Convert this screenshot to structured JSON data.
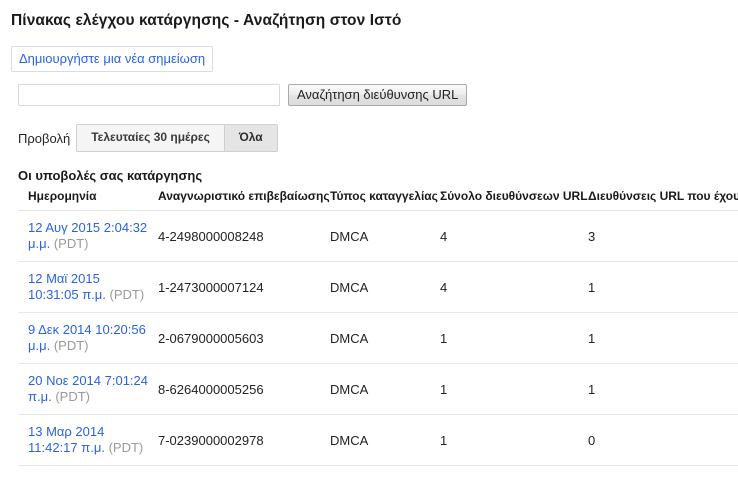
{
  "header": {
    "title": "Πίνακας ελέγχου κατάργησης - Αναζήτηση στον Ιστό"
  },
  "actions": {
    "new_notice_label": "Δημιουργήστε μια νέα σημείωση"
  },
  "search": {
    "value": "",
    "placeholder": "",
    "button_label": "Αναζήτηση διεύθυνσης URL"
  },
  "filter": {
    "label": "Προβολή",
    "options": [
      {
        "label": "Τελευταίες 30 ημέρες",
        "active": false
      },
      {
        "label": "Όλα",
        "active": true
      }
    ]
  },
  "table": {
    "heading": "Οι υποβολές σας κατάργησης",
    "columns": [
      "Ημερομηνία",
      "Αναγνωριστικό επιβεβαίωσης",
      "Τύπος καταγγελίας",
      "Σύνολο διευθύνσεων URL",
      "Διευθύνσεις URL που έχουν εγκριθεί"
    ],
    "rows": [
      {
        "date_main": "12 Αυγ 2015 2:04:32 μ.μ.",
        "timezone": "(PDT)",
        "confirmation_id": "4-2498000008248",
        "complaint_type": "DMCA",
        "total_urls": "4",
        "approved_urls": "3"
      },
      {
        "date_main": "12 Μαϊ 2015 10:31:05 π.μ.",
        "timezone": "(PDT)",
        "confirmation_id": "1-2473000007124",
        "complaint_type": "DMCA",
        "total_urls": "4",
        "approved_urls": "1"
      },
      {
        "date_main": "9 Δεκ 2014 10:20:56 μ.μ.",
        "timezone": "(PDT)",
        "confirmation_id": "2-0679000005603",
        "complaint_type": "DMCA",
        "total_urls": "1",
        "approved_urls": "1"
      },
      {
        "date_main": "20 Νοε 2014 7:01:24 π.μ.",
        "timezone": "(PDT)",
        "confirmation_id": "8-6264000005256",
        "complaint_type": "DMCA",
        "total_urls": "1",
        "approved_urls": "1"
      },
      {
        "date_main": "13 Μαρ 2014 11:42:17 π.μ.",
        "timezone": "(PDT)",
        "confirmation_id": "7-0239000002978",
        "complaint_type": "DMCA",
        "total_urls": "1",
        "approved_urls": "0"
      }
    ]
  },
  "colors": {
    "link": "#2b61e8",
    "muted": "#999999",
    "text": "#222222",
    "row_border": "#e8e8e8",
    "active_toggle_bg": "#e5e5e5"
  }
}
